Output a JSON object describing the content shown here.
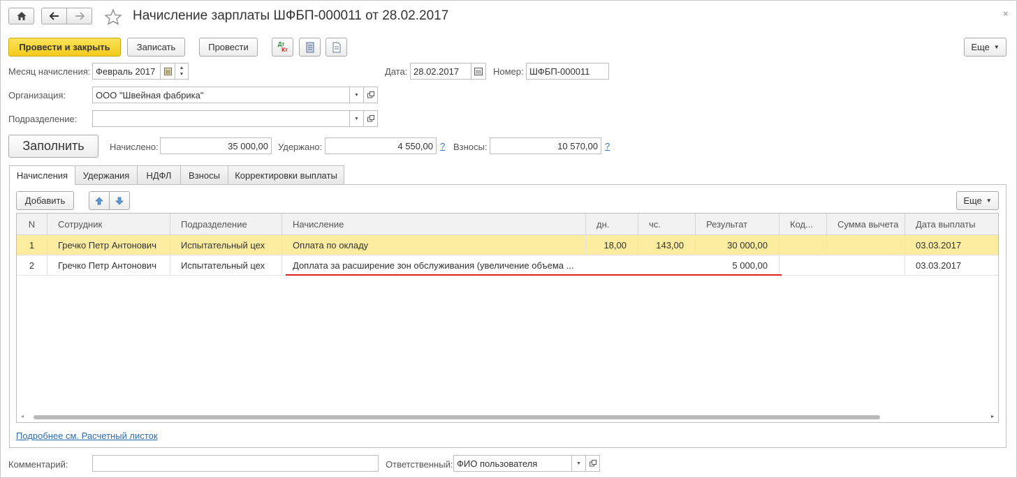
{
  "header": {
    "title": "Начисление зарплаты ШФБП-000011 от 28.02.2017"
  },
  "toolbar": {
    "post_close_label": "Провести и закрыть",
    "save_label": "Записать",
    "post_label": "Провести",
    "dtkt_label_top": "Дт",
    "dtkt_label_bottom": "Кт",
    "more_label": "Еще"
  },
  "form": {
    "month_label": "Месяц начисления:",
    "month_value": "Февраль 2017",
    "date_label": "Дата:",
    "date_value": "28.02.2017",
    "number_label": "Номер:",
    "number_value": "ШФБП-000011",
    "org_label": "Организация:",
    "org_value": "ООО \"Швейная фабрика\"",
    "dept_label": "Подразделение:",
    "dept_value": "",
    "fill_label": "Заполнить",
    "accrued_label": "Начислено:",
    "accrued_value": "35 000,00",
    "withheld_label": "Удержано:",
    "withheld_value": "4 550,00",
    "contrib_label": "Взносы:",
    "contrib_value": "10 570,00",
    "help_glyph": "?"
  },
  "tabs": [
    {
      "label": "Начисления"
    },
    {
      "label": "Удержания"
    },
    {
      "label": "НДФЛ"
    },
    {
      "label": "Взносы"
    },
    {
      "label": "Корректировки выплаты"
    }
  ],
  "table_toolbar": {
    "add_label": "Добавить",
    "more_label": "Еще"
  },
  "table": {
    "columns": [
      "N",
      "Сотрудник",
      "Подразделение",
      "Начисление",
      "дн.",
      "чс.",
      "Результат",
      "Код...",
      "Сумма вычета",
      "Дата выплаты"
    ],
    "rows": [
      {
        "n": "1",
        "employee": "Гречко Петр Антонович",
        "dept": "Испытательный цех",
        "accrual": "Оплата по окладу",
        "days": "18,00",
        "hours": "143,00",
        "result": "30 000,00",
        "code": "",
        "deduction": "",
        "pay_date": "03.03.2017"
      },
      {
        "n": "2",
        "employee": "Гречко Петр Антонович",
        "dept": "Испытательный цех",
        "accrual": "Доплата за расширение зон обслуживания (увеличение объема ...",
        "days": "",
        "hours": "",
        "result": "5 000,00",
        "code": "",
        "deduction": "",
        "pay_date": "03.03.2017"
      }
    ]
  },
  "footer": {
    "payslip_link": "Подробнее см. Расчетный листок",
    "comment_label": "Комментарий:",
    "comment_value": "",
    "responsible_label": "Ответственный:",
    "responsible_value": "ФИО пользователя"
  },
  "colors": {
    "primary_button": "#f2cb1c",
    "selected_row": "#fbeca0",
    "link": "#2b6cb0",
    "annotation_underline": "#e02020"
  }
}
